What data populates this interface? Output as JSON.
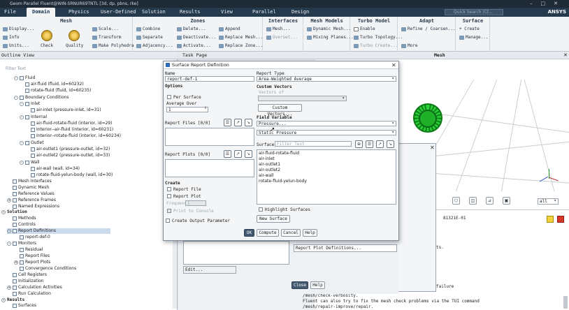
{
  "window": {
    "title": "Geom Parallel Fluent@WIN-SRNUR69TNTL [3d, dp, pbns, rke]"
  },
  "menu": {
    "tabs": [
      "File",
      "Domain",
      "Physics",
      "User-Defined",
      "Solution",
      "Results",
      "View",
      "Parallel",
      "Design"
    ],
    "active": "Domain",
    "search_placeholder": "Quick Search (Ct...",
    "logo": "ANSYS"
  },
  "ribbon": {
    "mesh": {
      "title": "Mesh",
      "display": "Display...",
      "info": "Info",
      "units": "Units...",
      "check": "Check",
      "quality": "Quality",
      "scale": "Scale...",
      "transform": "Transform",
      "make_polyhedra": "Make Polyhedra"
    },
    "zones": {
      "title": "Zones",
      "combine": "Combine",
      "separate": "Separate",
      "adjacency": "Adjacency...",
      "delete": "Delete...",
      "deactivate": "Deactivate...",
      "activate": "Activate...",
      "append": "Append",
      "replace_mesh": "Replace Mesh...",
      "replace_zone": "Replace Zone..."
    },
    "interfaces": {
      "title": "Interfaces",
      "mesh": "Mesh...",
      "overset": "Overset..."
    },
    "mesh_models": {
      "title": "Mesh Models",
      "dynamic_mesh": "Dynamic Mesh...",
      "mixing_planes": "Mixing Planes..."
    },
    "turbo_model": {
      "title": "Turbo Model",
      "enable": "Enable",
      "turbo_topology": "Turbo Topology...",
      "turbo_create": "Turbo Create..."
    },
    "adapt": {
      "title": "Adapt",
      "refine_coarsen": "Refine / Coarsen...",
      "more": "More"
    },
    "surface": {
      "title": "Surface",
      "create": "+ Create",
      "manage": "Manage..."
    }
  },
  "outline": {
    "title": "Outline View",
    "filter_placeholder": "Filter Text",
    "items": [
      {
        "label": "Fluid"
      },
      {
        "label": "air-fluid (fluid, id=60232)"
      },
      {
        "label": "rotate-fluid (fluid, id=60235)"
      },
      {
        "label": "Boundary Conditions"
      },
      {
        "label": "Inlet"
      },
      {
        "label": "air-inlet (pressure-inlet, id=31)"
      },
      {
        "label": "Internal"
      },
      {
        "label": "air-fluid-rotate-fluid (interior, id=29)"
      },
      {
        "label": "Interior--air-fluid (interior, id=60231)"
      },
      {
        "label": "Interior--rotate-fluid (interior, id=60234)"
      },
      {
        "label": "Outlet"
      },
      {
        "label": "air-outlet1 (pressure-outlet, id=32)"
      },
      {
        "label": "air-outlet2 (pressure-outlet, id=33)"
      },
      {
        "label": "Wall"
      },
      {
        "label": "air-wall (wall, id=34)"
      },
      {
        "label": "rotate-fluid-yelun-body (wall, id=30)"
      },
      {
        "label": "Mesh Interfaces"
      },
      {
        "label": "Dynamic Mesh"
      },
      {
        "label": "Reference Values"
      },
      {
        "label": "Reference Frames"
      },
      {
        "label": "Named Expressions"
      },
      {
        "label": "Solution"
      },
      {
        "label": "Methods"
      },
      {
        "label": "Controls"
      },
      {
        "label": "Report Definitions"
      },
      {
        "label": "report-def-0"
      },
      {
        "label": "Monitors"
      },
      {
        "label": "Residual"
      },
      {
        "label": "Report Files"
      },
      {
        "label": "Report Plots"
      },
      {
        "label": "Convergence Conditions"
      },
      {
        "label": "Cell Registers"
      },
      {
        "label": "Initialization"
      },
      {
        "label": "Calculation Activities"
      },
      {
        "label": "Run Calculation"
      },
      {
        "label": "Results"
      },
      {
        "label": "Surfaces"
      }
    ]
  },
  "task_page": {
    "title": "Task Page",
    "report_plot_definitions": "Report Plot Definitions...",
    "edit": "Edit...",
    "close": "Close",
    "help": "Help"
  },
  "graphics": {
    "title": "Mesh",
    "zoom_select": "all"
  },
  "console": {
    "lines": [
      "81321E-01",
      "ts.",
      "failure",
      "/mesh/check-verbosity.",
      "Fluent can also try to fix the mesh check problems via the TUI command",
      "/mesh/repair-improve/repair."
    ]
  },
  "dialog": {
    "title": "Surface Report Definition",
    "name_label": "Name",
    "name_value": "report-def-1",
    "options_label": "Options",
    "per_surface": "Per Surface",
    "average_over_label": "Average Over",
    "average_over_value": "1",
    "report_files_label": "Report Files [0/0]",
    "report_plots_label": "Report Plots [0/0]",
    "create_label": "Create",
    "report_file": "Report File",
    "report_plot": "Report Plot",
    "frequency_label": "Frequency",
    "frequency_value": "1",
    "print_to_console": "Print to Console",
    "create_output_parameter": "Create Output Parameter",
    "report_type_label": "Report Type",
    "report_type_value": "Area-Weighted Average",
    "custom_vectors_label": "Custom Vectors",
    "vectors_of_label": "Vectors of",
    "custom_vectors_button": "Custom Vectors...",
    "field_variable_label": "Field Variable",
    "field_variable_value": "Pressure...",
    "field_sub_value": "Static Pressure",
    "surfaces_label": "Surfaces",
    "surfaces_filter_placeholder": "Filter Text",
    "surfaces": [
      "air-fluid-rotate-fluid",
      "air-inlet",
      "air-outlet1",
      "air-outlet2",
      "air-wall",
      "rotate-fluid-yelun-body"
    ],
    "highlight_surfaces": "Highlight Surfaces",
    "new_surface": "New Surface",
    "ok": "OK",
    "compute": "Compute",
    "cancel": "Cancel",
    "help": "Help"
  }
}
